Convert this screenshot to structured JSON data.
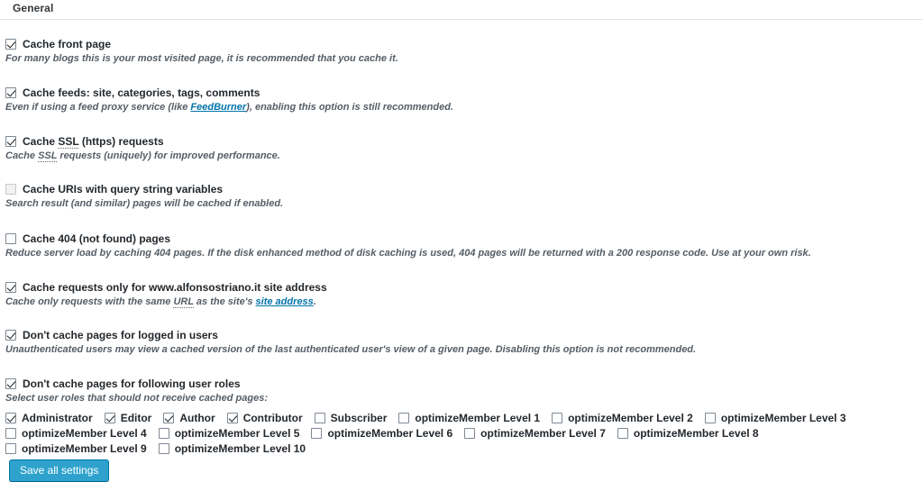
{
  "panel": {
    "title": "General"
  },
  "options": [
    {
      "id": "cache-front-page",
      "label": "Cache front page",
      "checked": true,
      "disabled": false,
      "description": "For many blogs this is your most visited page, it is recommended that you cache it."
    },
    {
      "id": "cache-feeds",
      "label": "Cache feeds: site, categories, tags, comments",
      "checked": true,
      "disabled": false,
      "description_before": "Even if using a feed proxy service (like ",
      "description_link": "FeedBurner",
      "description_after": "), enabling this option is still recommended."
    },
    {
      "id": "cache-ssl-requests",
      "label_parts": [
        "Cache ",
        "SSL",
        " (https) requests"
      ],
      "label": "Cache SSL (https) requests",
      "checked": true,
      "disabled": false,
      "description_parts": [
        "Cache ",
        "SSL",
        " requests (uniquely) for improved performance."
      ],
      "description": "Cache SSL requests (uniquely) for improved performance."
    },
    {
      "id": "cache-query-string-uris",
      "label": "Cache URIs with query string variables",
      "checked": false,
      "disabled": true,
      "description": "Search result (and similar) pages will be cached if enabled."
    },
    {
      "id": "cache-404-pages",
      "label": "Cache 404 (not found) pages",
      "checked": false,
      "disabled": false,
      "description": "Reduce server load by caching 404 pages. If the disk enhanced method of disk caching is used, 404 pages will be returned with a 200 response code. Use at your own risk."
    },
    {
      "id": "cache-site-address-only",
      "label": "Cache requests only for www.alfonsostriano.it site address",
      "checked": true,
      "disabled": false,
      "description_before": "Cache only requests with the same ",
      "description_abbr": "URL",
      "description_mid": " as the site's ",
      "description_link": "site address",
      "description_after": ".",
      "description": "Cache only requests with the same URL as the site's site address."
    },
    {
      "id": "dont-cache-logged-in",
      "label": "Don't cache pages for logged in users",
      "checked": true,
      "disabled": false,
      "description": "Unauthenticated users may view a cached version of the last authenticated user's view of a given page. Disabling this option is not recommended."
    },
    {
      "id": "dont-cache-user-roles",
      "label": "Don't cache pages for following user roles",
      "checked": true,
      "disabled": false,
      "description": "Select user roles that should not receive cached pages:"
    }
  ],
  "roles": [
    {
      "id": "administrator",
      "label": "Administrator",
      "checked": true
    },
    {
      "id": "editor",
      "label": "Editor",
      "checked": true
    },
    {
      "id": "author",
      "label": "Author",
      "checked": true
    },
    {
      "id": "contributor",
      "label": "Contributor",
      "checked": true
    },
    {
      "id": "subscriber",
      "label": "Subscriber",
      "checked": false
    },
    {
      "id": "optimizemember-level-1",
      "label": "optimizeMember Level 1",
      "checked": false
    },
    {
      "id": "optimizemember-level-2",
      "label": "optimizeMember Level 2",
      "checked": false
    },
    {
      "id": "optimizemember-level-3",
      "label": "optimizeMember Level 3",
      "checked": false
    },
    {
      "id": "optimizemember-level-4",
      "label": "optimizeMember Level 4",
      "checked": false
    },
    {
      "id": "optimizemember-level-5",
      "label": "optimizeMember Level 5",
      "checked": false
    },
    {
      "id": "optimizemember-level-6",
      "label": "optimizeMember Level 6",
      "checked": false
    },
    {
      "id": "optimizemember-level-7",
      "label": "optimizeMember Level 7",
      "checked": false
    },
    {
      "id": "optimizemember-level-8",
      "label": "optimizeMember Level 8",
      "checked": false
    },
    {
      "id": "optimizemember-level-9",
      "label": "optimizeMember Level 9",
      "checked": false
    },
    {
      "id": "optimizemember-level-10",
      "label": "optimizeMember Level 10",
      "checked": false
    }
  ],
  "actions": {
    "save_label": "Save all settings"
  },
  "colors": {
    "primary_button_bg": "#2ea2cc",
    "primary_button_border": "#0074a2",
    "link": "#0073aa",
    "label_text": "#23282d",
    "description_text": "#555d66",
    "rule": "#e5e5e5"
  }
}
